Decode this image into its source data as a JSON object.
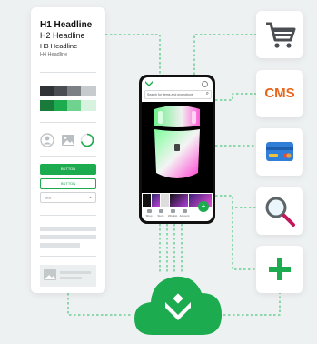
{
  "design_system": {
    "h1": "H1 Headline",
    "h2": "H2 Headline",
    "h3": "H3 Headline",
    "h4": "H4 Headline",
    "button_primary": "BUTTON",
    "button_secondary": "BUTTON",
    "select_placeholder": "Text",
    "palette": [
      "#2f3336",
      "#4a4e52",
      "#7b8084",
      "#c7cbce",
      "#1a7a3a",
      "#1cab4e",
      "#6fd38f",
      "#d7f3df"
    ]
  },
  "phone": {
    "search_placeholder": "Search for items and promotions",
    "tabs": [
      "Shop",
      "Store",
      "Wishlist",
      "Account"
    ],
    "fab": "+",
    "brand_color": "#1cab4e"
  },
  "integrations": {
    "cart": "shopping-cart-icon",
    "cms_label": "CMS",
    "payment": "credit-card-icon",
    "search": "magnifier-icon",
    "add": "plus-icon"
  },
  "cloud": {
    "icon": "cloud-logo-icon",
    "color": "#1cab4e"
  },
  "colors": {
    "accent": "#1cab4e",
    "cms": "#e8651a",
    "card": "#2f7fd8",
    "background": "#eef1f2"
  }
}
